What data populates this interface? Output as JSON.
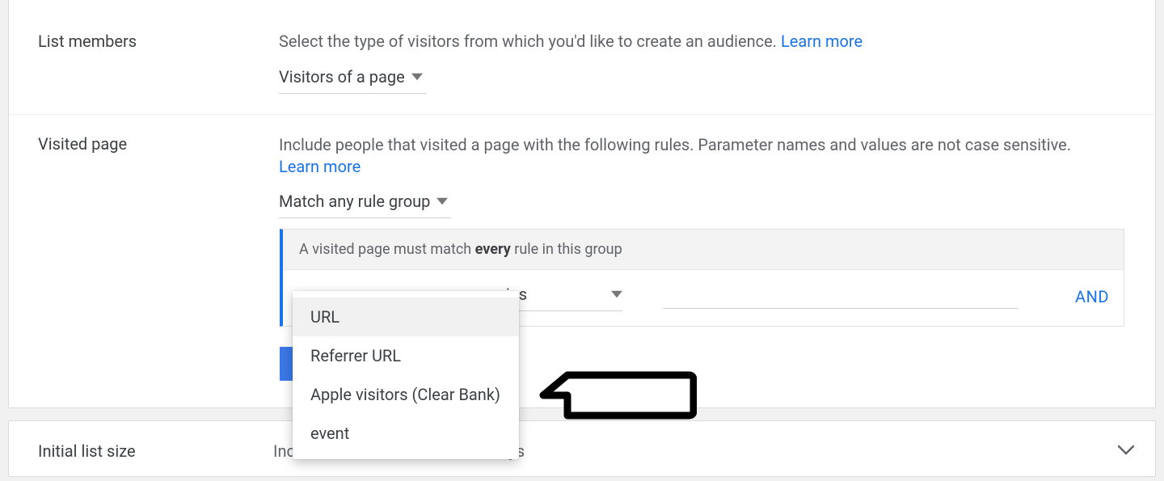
{
  "sections": {
    "list_members": {
      "label": "List members",
      "desc": "Select the type of visitors from which you'd like to create an audience.",
      "learn_more": "Learn more",
      "selector_value": "Visitors of a page"
    },
    "visited_page": {
      "label": "Visited page",
      "desc": "Include people that visited a page with the following rules. Parameter names and values are not case sensitive.",
      "learn_more": "Learn more",
      "match_selector_value": "Match any rule group",
      "group_header_prefix": "A visited page must match ",
      "group_header_bold": "every",
      "group_header_suffix": " rule in this group",
      "operator": "ains",
      "and_label": "AND"
    },
    "initial_list_size": {
      "label": "Initial list size",
      "desc_prefix": "Inc",
      "desc_suffix": "ays"
    }
  },
  "dropdown": {
    "items": [
      "URL",
      "Referrer URL",
      "Apple visitors (Clear Bank)",
      "event"
    ],
    "selected_index": 0
  }
}
